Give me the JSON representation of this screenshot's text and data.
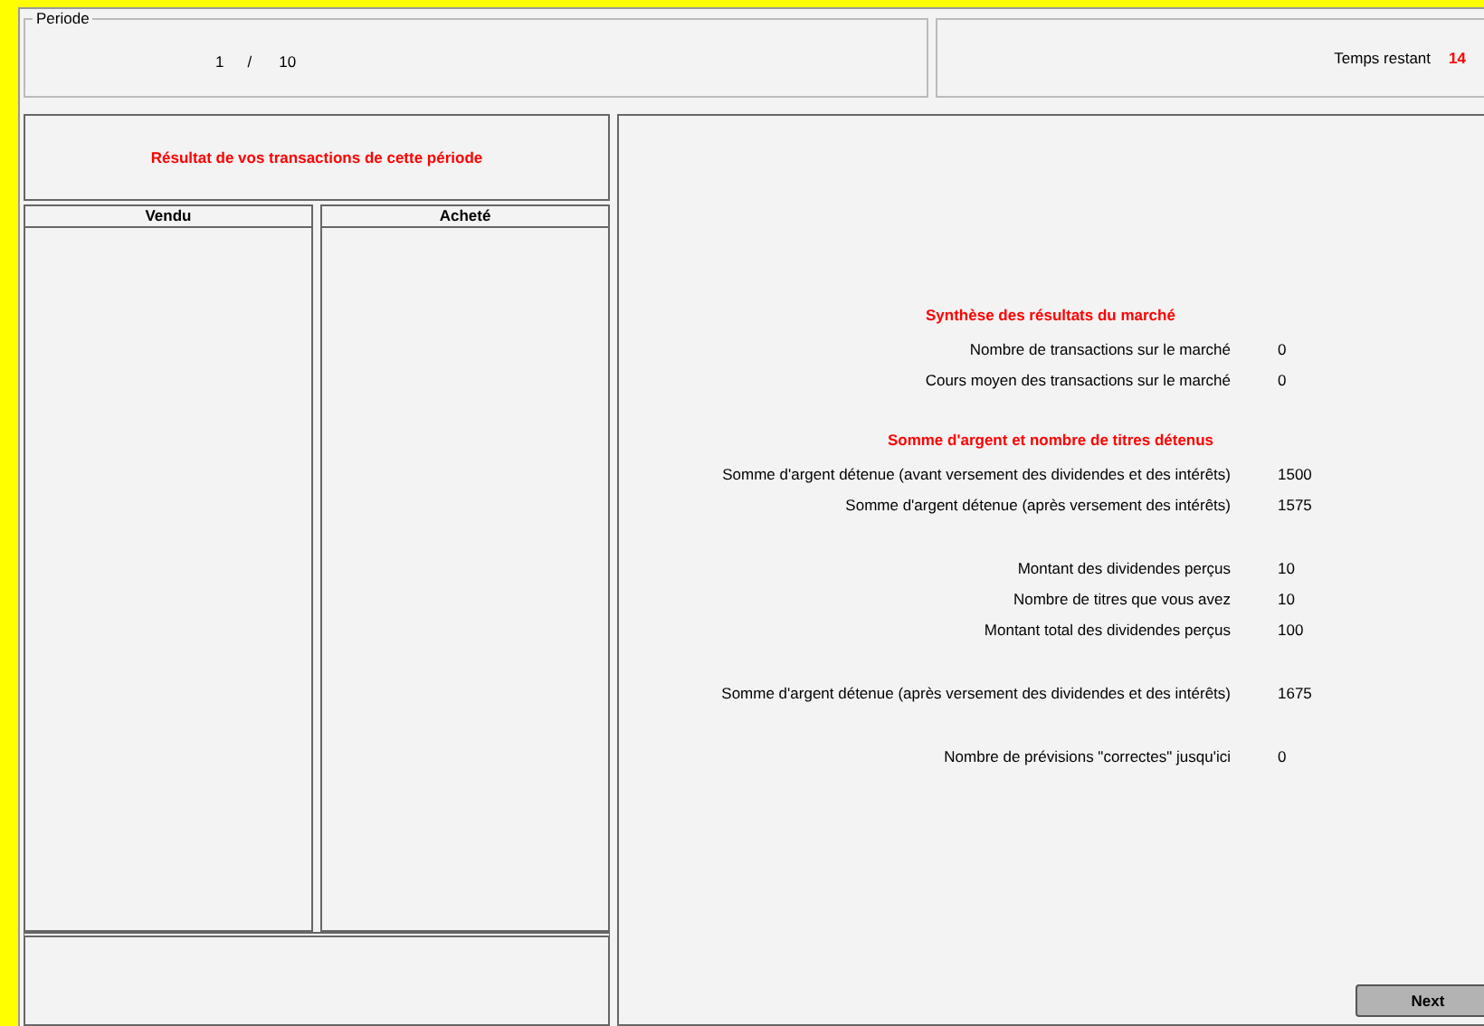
{
  "period": {
    "legend": "Periode",
    "current": "1",
    "separator": "/",
    "total": "10"
  },
  "timer": {
    "label": "Temps restant",
    "value": "14"
  },
  "transactions": {
    "title": "Résultat de vos transactions de cette période",
    "columns": [
      {
        "heading": "Vendu"
      },
      {
        "heading": "Acheté"
      }
    ]
  },
  "summary": {
    "sections": [
      {
        "title": "Synthèse des résultats du marché",
        "rows": [
          {
            "label": "Nombre de transactions sur le marché",
            "value": "0"
          },
          {
            "label": "Cours moyen des transactions sur le marché",
            "value": "0"
          }
        ]
      },
      {
        "title": "Somme d'argent et nombre de titres détenus",
        "rows": [
          {
            "label": "Somme d'argent détenue (avant versement des dividendes et des intérêts)",
            "value": "1500"
          },
          {
            "label": "Somme d'argent détenue (après versement des intérêts)",
            "value": "1575"
          }
        ]
      },
      {
        "rows": [
          {
            "label": "Montant des dividendes perçus",
            "value": "10"
          },
          {
            "label": "Nombre de titres que vous avez",
            "value": "10"
          },
          {
            "label": "Montant total des dividendes perçus",
            "value": "100"
          }
        ]
      },
      {
        "rows": [
          {
            "label": "Somme d'argent détenue (après versement des dividendes et des intérêts)",
            "value": "1675"
          }
        ]
      },
      {
        "rows": [
          {
            "label": "Nombre de prévisions \"correctes\" jusqu'ici",
            "value": "0"
          }
        ]
      }
    ]
  },
  "buttons": [
    {
      "label": "Next"
    }
  ]
}
